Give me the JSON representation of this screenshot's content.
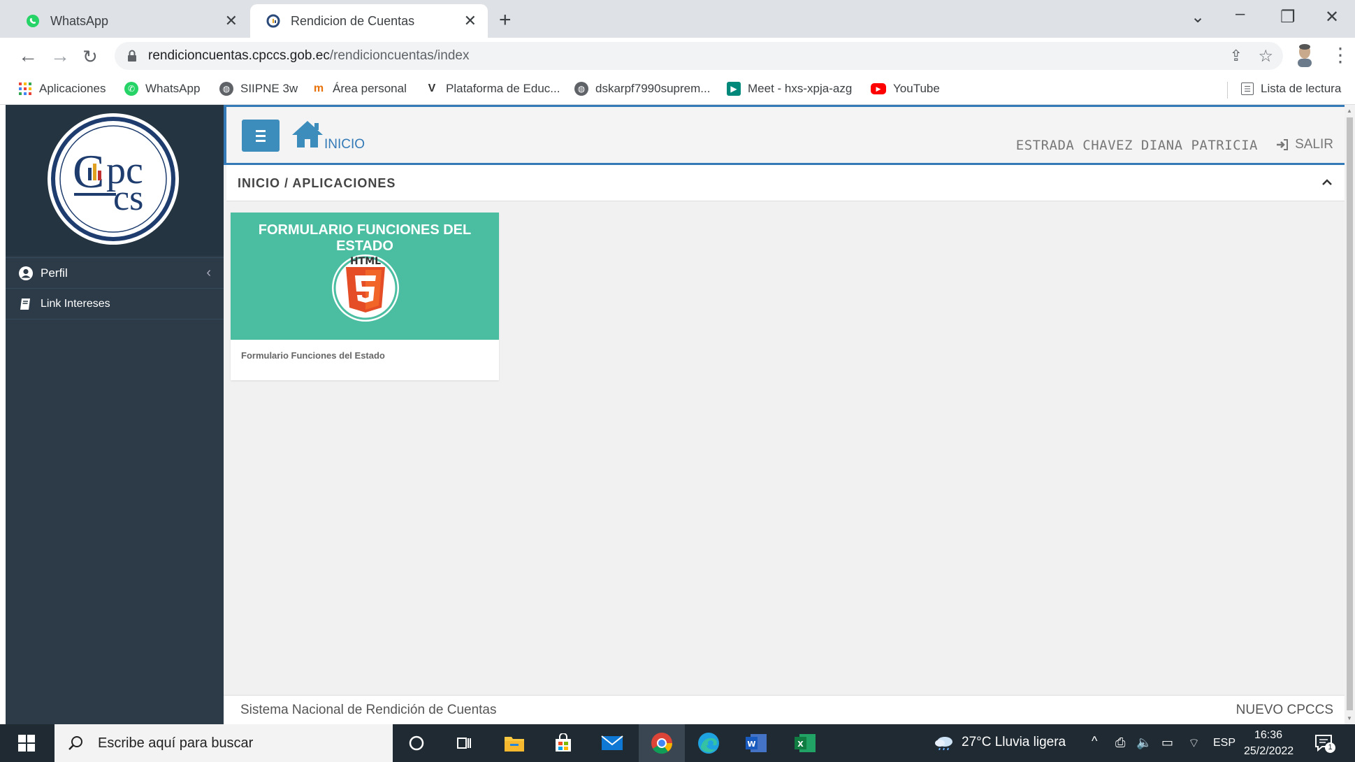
{
  "browser": {
    "tabs": [
      {
        "title": "WhatsApp",
        "active": false
      },
      {
        "title": "Rendicion de Cuentas",
        "active": true
      }
    ],
    "url_host": "rendicioncuentas.cpccs.gob.ec",
    "url_path": "/rendicioncuentas/index",
    "bookmarks": [
      "Aplicaciones",
      "WhatsApp",
      "SIIPNE 3w",
      "Área personal",
      "Plataforma de Educ...",
      "dskarpf7990suprem...",
      "Meet - hxs-xpja-azg",
      "YouTube"
    ],
    "reading_list": "Lista de lectura"
  },
  "sidebar": {
    "logo_text": "CPCCS",
    "items": [
      {
        "label": "Perfil"
      },
      {
        "label": "Link Intereses"
      }
    ]
  },
  "header": {
    "home_label": "INICIO",
    "user_name": "ESTRADA CHAVEZ DIANA PATRICIA",
    "logout_label": "SALIR"
  },
  "breadcrumb": "INICIO / APLICACIONES",
  "card": {
    "title": "FORMULARIO FUNCIONES DEL ESTADO",
    "icon_text": "HTML",
    "description": "Formulario Funciones del Estado"
  },
  "footer": {
    "left": "Sistema Nacional de Rendición de Cuentas",
    "right": "NUEVO CPCCS"
  },
  "taskbar": {
    "search_placeholder": "Escribe aquí para buscar",
    "weather": "27°C  Lluvia ligera",
    "language": "ESP",
    "time": "16:36",
    "date": "25/2/2022",
    "notification_count": "1"
  },
  "colors": {
    "sidebar": "#2c3b47",
    "card": "#4bbea2",
    "accent": "#337ab7",
    "html5": "#e44d26"
  }
}
